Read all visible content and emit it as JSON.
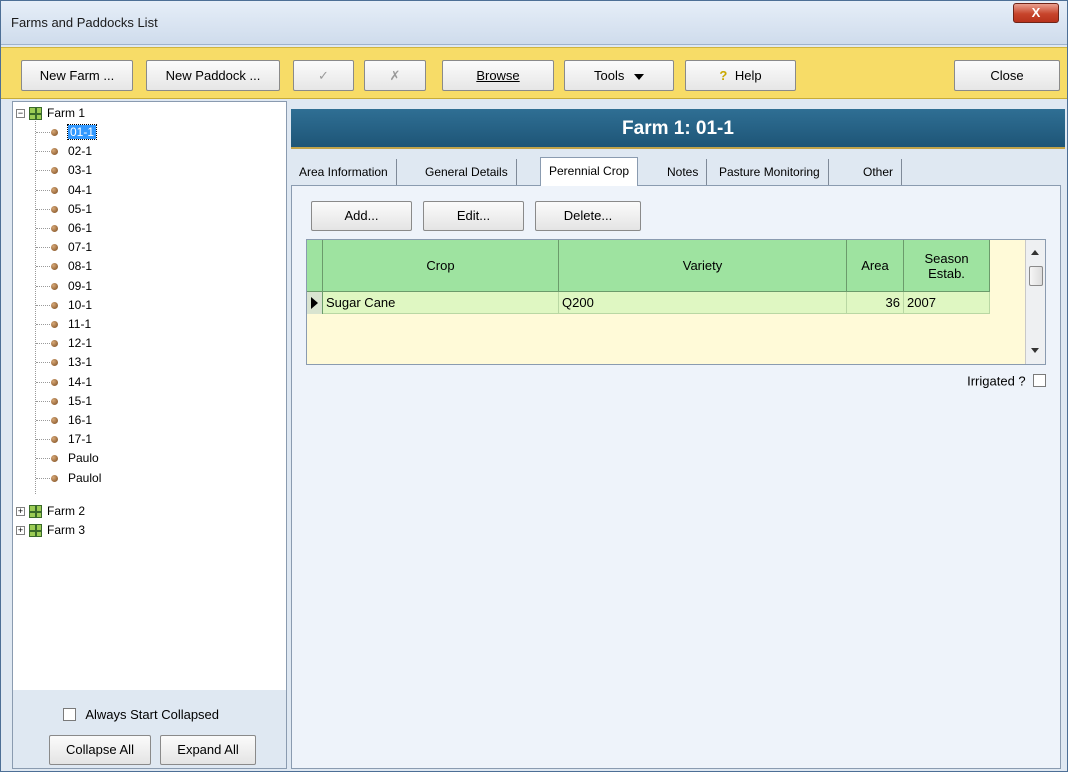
{
  "window": {
    "title": "Farms and Paddocks List",
    "close_glyph": "X"
  },
  "toolbar": {
    "new_farm": "New Farm ...",
    "new_paddock": "New Paddock ...",
    "edit_disabled": "✓",
    "delete_disabled": "✗",
    "browse": "Browse",
    "tools": "Tools",
    "help": "Help",
    "close": "Close"
  },
  "tree": {
    "farm1": "Farm 1",
    "paddocks": [
      "01-1",
      "02-1",
      "03-1",
      "04-1",
      "05-1",
      "06-1",
      "07-1",
      "08-1",
      "09-1",
      "10-1",
      "11-1",
      "12-1",
      "13-1",
      "14-1",
      "15-1",
      "16-1",
      "17-1",
      "Paulo",
      "Paulol"
    ],
    "farm2": "Farm 2",
    "farm3": "Farm 3",
    "always_collapsed": "Always Start Collapsed",
    "collapse_all": "Collapse All",
    "expand_all": "Expand All"
  },
  "header": {
    "title": "Farm 1: 01-1"
  },
  "tabs": [
    "Area Information",
    "General Details",
    "Perennial Crop",
    "Notes",
    "Pasture Monitoring",
    "Other"
  ],
  "actions": {
    "add": "Add...",
    "edit": "Edit...",
    "delete": "Delete..."
  },
  "grid": {
    "columns": [
      "Crop",
      "Variety",
      "Area",
      "Season\nEstab."
    ],
    "rows": [
      {
        "crop": "Sugar Cane",
        "variety": "Q200",
        "area": "36",
        "season": "2007"
      }
    ]
  },
  "irrigated": "Irrigated ?"
}
